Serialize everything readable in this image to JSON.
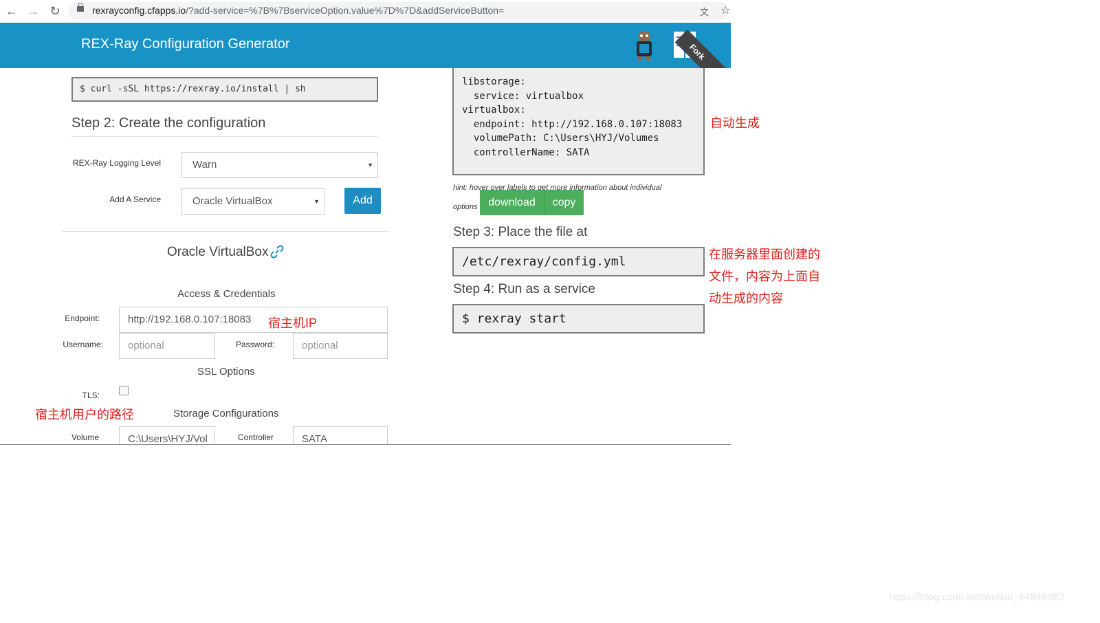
{
  "browser": {
    "url_host": "rexrayconfig.cfapps.io",
    "url_rest": "/?add-service=%7B%7BserviceOption.value%7D%7D&addServiceButton="
  },
  "header": {
    "title": "REX-Ray Configuration Generator",
    "ribbon": "Fork"
  },
  "step1": {
    "command": "$ curl -sSL https://rexray.io/install | sh"
  },
  "step2": {
    "heading": "Step 2: Create the configuration",
    "logging_label": "REX-Ray Logging Level",
    "logging_value": "Warn",
    "service_label": "Add A Service",
    "service_value": "Oracle VirtualBox",
    "add_button": "Add"
  },
  "service": {
    "name": "Oracle VirtualBox",
    "access_heading": "Access & Credentials",
    "endpoint_label": "Endpoint:",
    "endpoint_value": "http://192.168.0.107:18083",
    "username_label": "Username:",
    "username_placeholder": "optional",
    "password_label": "Password:",
    "password_placeholder": "optional",
    "ssl_heading": "SSL Options",
    "tls_label": "TLS:",
    "storage_heading": "Storage Configurations",
    "volume_label": "Volume",
    "volume_value": "C:\\Users\\HYJ/Vol",
    "controller_label": "Controller",
    "controller_value": "SATA"
  },
  "preview": {
    "yaml": "libstorage:\n  service: virtualbox\nvirtualbox:\n  endpoint: http://192.168.0.107:18083\n  volumePath: C:\\Users\\HYJ/Volumes\n  controllerName: SATA",
    "hint": "hint: hover over labels to get more information about individual options",
    "download_button": "download",
    "copy_button": "copy",
    "step3_heading": "Step 3: Place the file at",
    "step3_path": "/etc/rexray/config.yml",
    "step4_heading": "Step 4: Run as a service",
    "step4_command": "$ rexray start"
  },
  "annotations": {
    "auto_generated": "自动生成",
    "host_ip": "宿主机IP",
    "host_user_path": "宿主机用户的路径",
    "file_note_line1": "在服务器里面创建的",
    "file_note_line2": "文件，内容为上面自",
    "file_note_line3": "动生成的内容"
  },
  "watermark": "https://blog.csdn.net/weixin_44848382",
  "colors": {
    "header_bg": "#1993c6",
    "add_button": "#1e8dc1",
    "green_button": "#4cae5a",
    "annotation_red": "#e0201b"
  }
}
